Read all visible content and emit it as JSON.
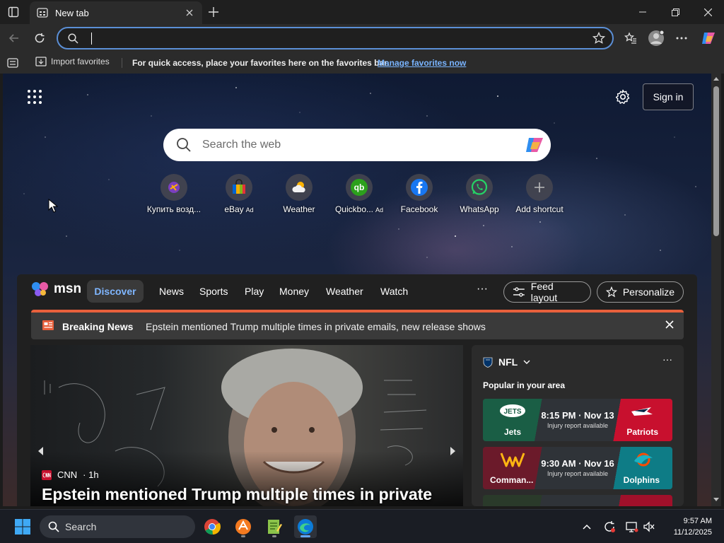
{
  "browser": {
    "tab_title": "New tab",
    "address_value": ""
  },
  "favorites_bar": {
    "import_label": "Import favorites",
    "hint": "For quick access, place your favorites here on the favorites bar.",
    "manage_link": "Manage favorites now"
  },
  "newtab": {
    "signin_label": "Sign in",
    "search_placeholder": "Search the web",
    "shortcuts": [
      {
        "label": "Купить возд...",
        "ad": ""
      },
      {
        "label": "eBay",
        "ad": "Ad"
      },
      {
        "label": "Weather",
        "ad": ""
      },
      {
        "label": "Quickbo...",
        "ad": "Ad"
      },
      {
        "label": "Facebook",
        "ad": ""
      },
      {
        "label": "WhatsApp",
        "ad": ""
      },
      {
        "label": "Add shortcut",
        "ad": ""
      }
    ]
  },
  "msn": {
    "logo_text": "msn",
    "nav": [
      "Discover",
      "News",
      "Sports",
      "Play",
      "Money",
      "Weather",
      "Watch"
    ],
    "more": "···",
    "feed_layout": "Feed layout",
    "personalize": "Personalize",
    "breaking_title": "Breaking News",
    "breaking_text": "Epstein mentioned Trump multiple times in private emails, new release shows",
    "hero": {
      "source": "CNN",
      "age": "· 1h",
      "headline": "Epstein mentioned Trump multiple times in private"
    },
    "nfl": {
      "title": "NFL",
      "subtitle": "Popular in your area",
      "games": [
        {
          "home": "Jets",
          "away": "Patriots",
          "time": "8:15 PM · Nov 13",
          "note": "Injury report available",
          "home_color": "#1a5e45",
          "away_color": "#c8102e"
        },
        {
          "home": "Comman...",
          "away": "Dolphins",
          "time": "9:30 AM · Nov 16",
          "note": "Injury report available",
          "home_color": "#6b1a2a",
          "away_color": "#0e7c86"
        }
      ]
    }
  },
  "taskbar": {
    "search_label": "Search",
    "time": "9:57 AM",
    "date": "11/12/2025"
  },
  "colors": {
    "accent": "#5b8fd6",
    "link": "#79b4ff",
    "breaking": "#e8603c"
  }
}
